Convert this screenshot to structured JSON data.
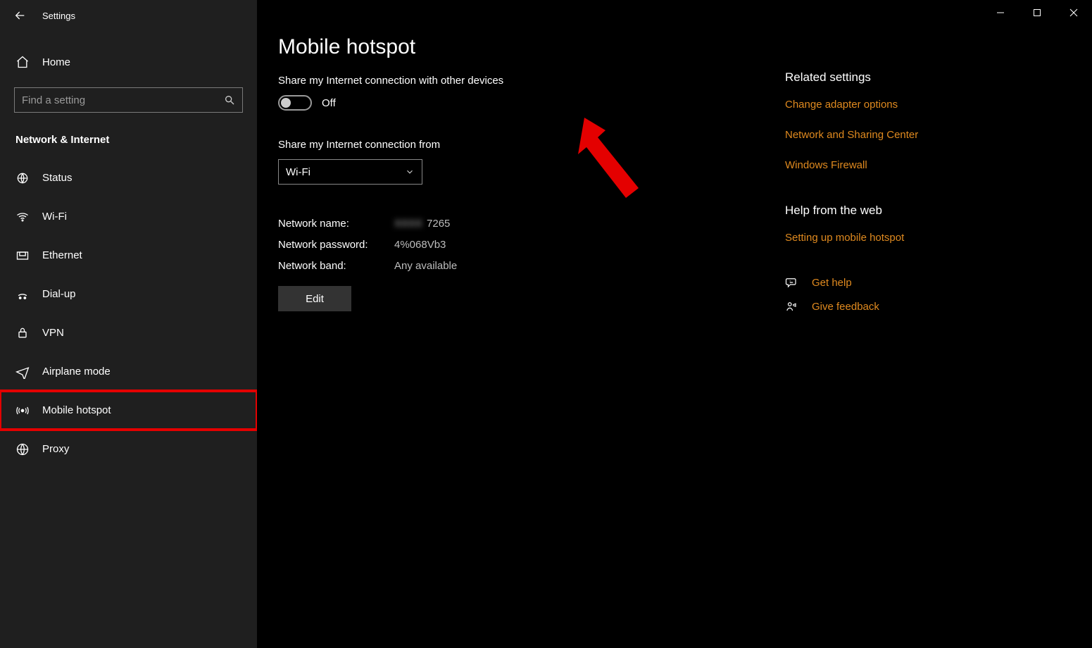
{
  "window": {
    "title": "Settings"
  },
  "sidebar": {
    "home_label": "Home",
    "search_placeholder": "Find a setting",
    "category_label": "Network & Internet",
    "items": [
      {
        "label": "Status"
      },
      {
        "label": "Wi-Fi"
      },
      {
        "label": "Ethernet"
      },
      {
        "label": "Dial-up"
      },
      {
        "label": "VPN"
      },
      {
        "label": "Airplane mode"
      },
      {
        "label": "Mobile hotspot"
      },
      {
        "label": "Proxy"
      }
    ]
  },
  "main": {
    "heading": "Mobile hotspot",
    "share_label": "Share my Internet connection with other devices",
    "toggle_state": "Off",
    "share_from_label": "Share my Internet connection from",
    "share_from_value": "Wi-Fi",
    "network_name_label": "Network name:",
    "network_name_value": "7265",
    "network_name_prefix_blurred": "XXXX",
    "network_password_label": "Network password:",
    "network_password_value": "4%068Vb3",
    "network_band_label": "Network band:",
    "network_band_value": "Any available",
    "edit_label": "Edit"
  },
  "right": {
    "related_title": "Related settings",
    "related_links": [
      "Change adapter options",
      "Network and Sharing Center",
      "Windows Firewall"
    ],
    "help_title": "Help from the web",
    "help_links": [
      "Setting up mobile hotspot"
    ],
    "get_help_label": "Get help",
    "feedback_label": "Give feedback"
  }
}
